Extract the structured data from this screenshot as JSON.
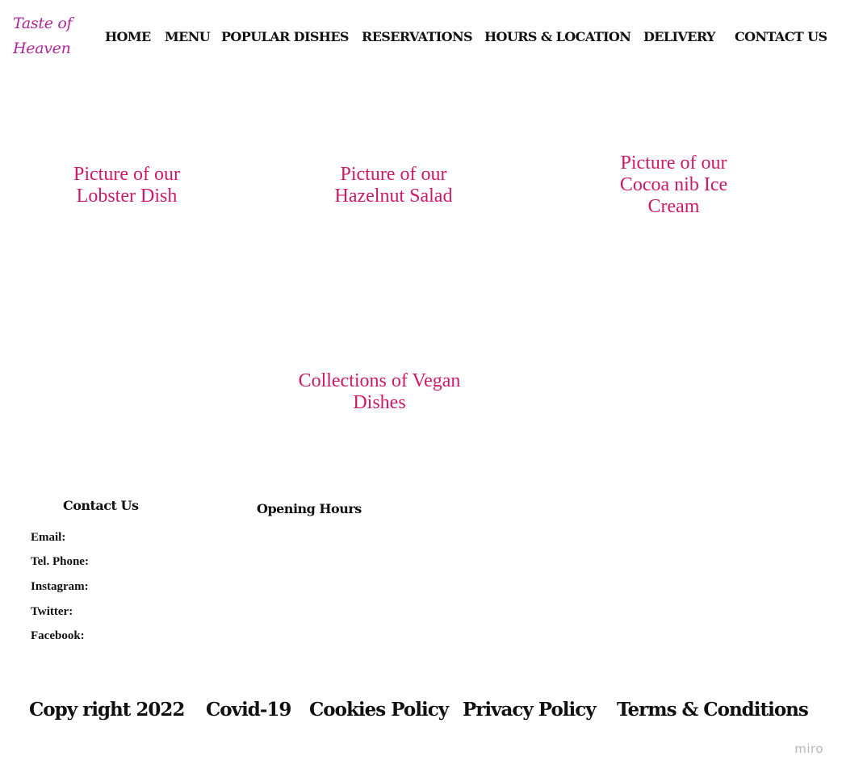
{
  "logo": {
    "line1": "Taste of",
    "line2": "Heaven"
  },
  "nav": {
    "home": "HOME",
    "menu": "MENU",
    "popular": "POPULAR DISHES",
    "reservations": "RESERVATIONS",
    "hours": "HOURS & LOCATION",
    "delivery": "DELIVERY",
    "contact": "CONTACT US"
  },
  "dishes": {
    "lobster": "Picture of our Lobster Dish",
    "salad": "Picture of our Hazelnut Salad",
    "icecream": "Picture of our Cocoa nib Ice Cream",
    "vegan": "Collections of Vegan Dishes"
  },
  "footer": {
    "contact_heading": "Contact Us",
    "hours_heading": "Opening Hours",
    "email_label": "Email:",
    "phone_label": "Tel. Phone:",
    "instagram_label": "Instagram:",
    "twitter_label": "Twitter:",
    "facebook_label": "Facebook:"
  },
  "bottom": {
    "copyright": "Copy right 2022",
    "covid": "Covid-19",
    "cookies": "Cookies Policy",
    "privacy": "Privacy Policy",
    "terms": "Terms & Conditions"
  },
  "watermark": "miro",
  "colors": {
    "logo": "#b0279a",
    "dish_text": "#cc1a6a",
    "text": "#111111",
    "watermark": "#b8b8b8"
  }
}
